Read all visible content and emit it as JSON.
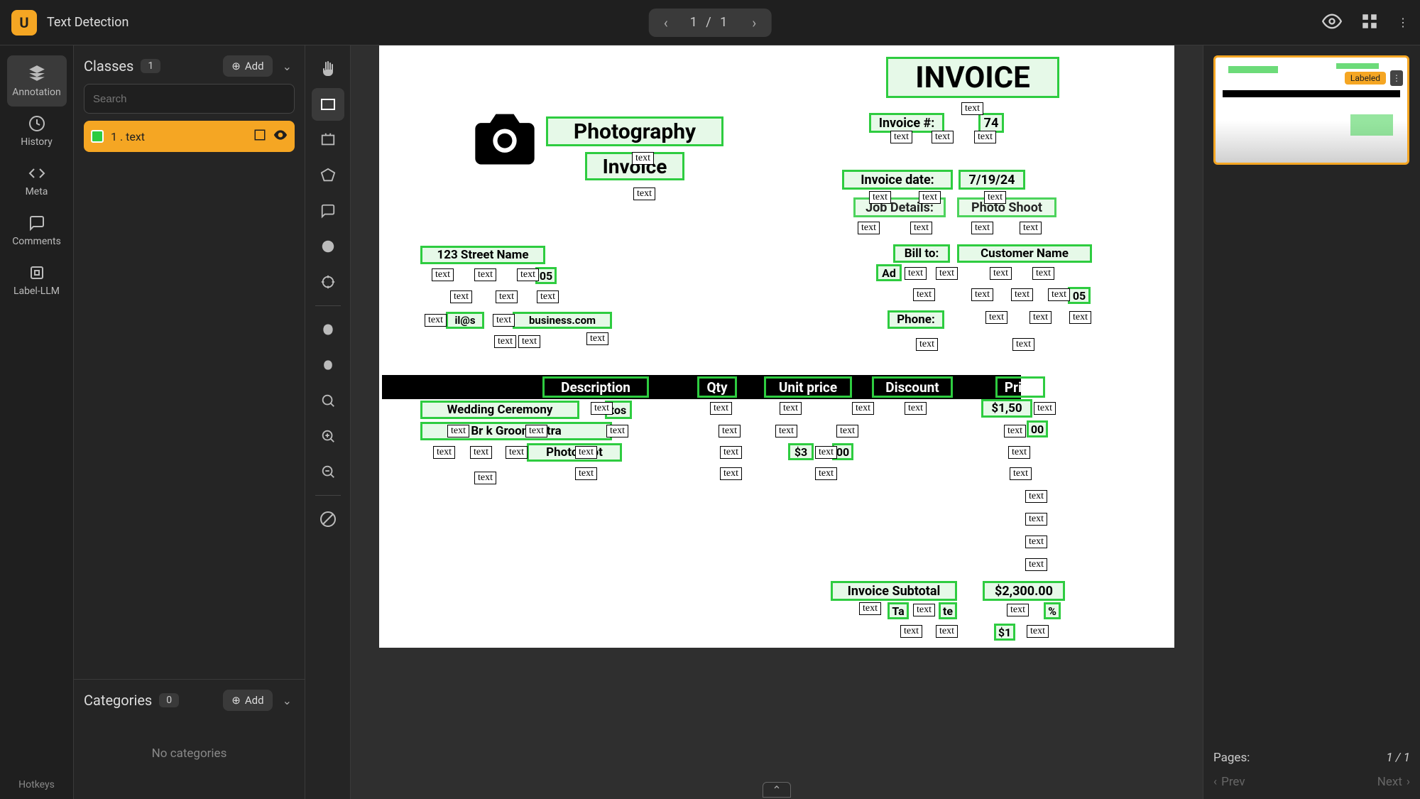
{
  "header": {
    "title": "Text Detection",
    "pager": "1 / 1"
  },
  "nav": {
    "items": [
      {
        "label": "Annotation"
      },
      {
        "label": "History"
      },
      {
        "label": "Meta"
      },
      {
        "label": "Comments"
      },
      {
        "label": "Label-LLM"
      }
    ],
    "hotkeys": "Hotkeys"
  },
  "classes": {
    "title": "Classes",
    "count": "1",
    "add": "Add",
    "search_placeholder": "Search",
    "row_label": "1 . text"
  },
  "categories": {
    "title": "Categories",
    "count": "0",
    "add": "Add",
    "empty": "No categories"
  },
  "thumb": {
    "badge": "Labeled"
  },
  "right_footer": {
    "pages_label": "Pages:",
    "pages_value": "1 / 1",
    "prev": "Prev",
    "next": "Next"
  },
  "document": {
    "camera_exists": true,
    "headings": {
      "invoice": "INVOICE",
      "photography": "Photography",
      "invoice2": "Invoice",
      "invoice_num_label": "Invoice #:",
      "invoice_num_value": "74",
      "invoice_date_label": "Invoice date:",
      "invoice_date_value": "7/19/24",
      "job_details": "Job Details:",
      "job_value": "Photo Shoot",
      "street": "123 Street Name",
      "bill_to": "Bill to:",
      "customer": "Customer Name",
      "address_label": "Ad",
      "phone_label": "Phone:",
      "email_fragment": "il@s",
      "business_fragment": "business.com",
      "col_description": "Description",
      "col_qty": "Qty",
      "col_unit": "Unit price",
      "col_discount": "Discount",
      "col_price": "Price",
      "wedding": "Wedding Ceremony",
      "ceremony_suffix": "tos",
      "bride_groom": "Br     k Groom   ortra",
      "photoshoot": "Photoboot",
      "price1": "$1,50",
      "price_frag_00": "00",
      "price_300": "$3",
      "subtotal_label": "Invoice Subtotal",
      "subtotal_value": "$2,300.00",
      "tax_label": "Ta",
      "tax_rate_suffix": "te",
      "tax_pct": "%",
      "total_prefix": "$1"
    },
    "text_tag": "text",
    "annotation_class": "text",
    "address_suffix": "05",
    "zip_suffix": "05"
  }
}
